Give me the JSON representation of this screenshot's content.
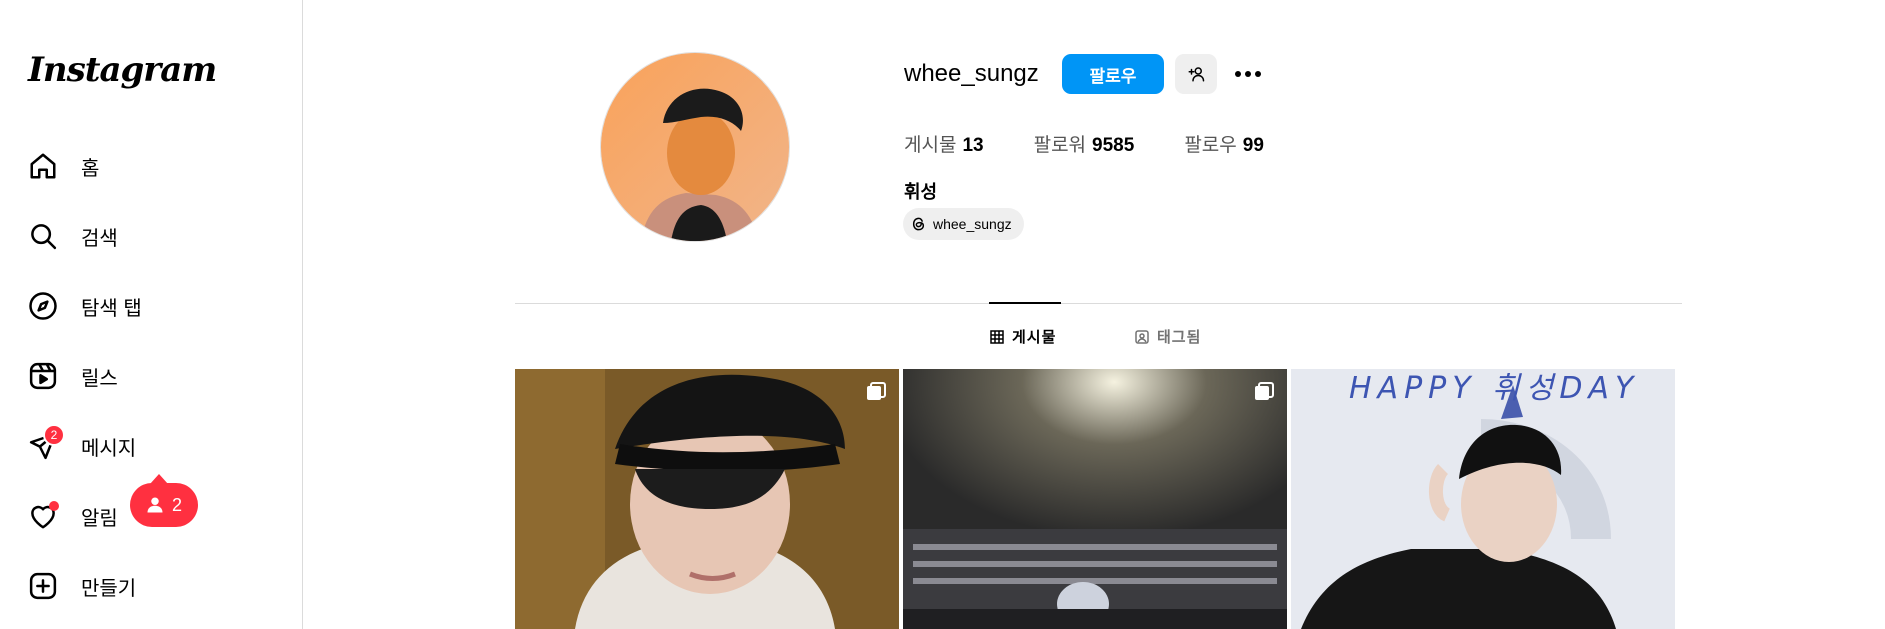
{
  "app": {
    "logo_text": "Instagram"
  },
  "sidebar": {
    "items": [
      {
        "label": "홈",
        "icon": "home-icon"
      },
      {
        "label": "검색",
        "icon": "search-icon"
      },
      {
        "label": "탐색 탭",
        "icon": "explore-icon"
      },
      {
        "label": "릴스",
        "icon": "reels-icon"
      },
      {
        "label": "메시지",
        "icon": "messenger-icon",
        "badge": "2"
      },
      {
        "label": "알림",
        "icon": "heart-icon"
      },
      {
        "label": "만들기",
        "icon": "create-icon"
      }
    ],
    "notification_pill": {
      "count": "2",
      "icon": "person-icon"
    }
  },
  "profile": {
    "username": "whee_sungz",
    "follow_label": "팔로우",
    "stats": [
      {
        "label": "게시물",
        "value": "13"
      },
      {
        "label": "팔로워",
        "value": "9585"
      },
      {
        "label": "팔로우",
        "value": "99"
      }
    ],
    "full_name": "휘성",
    "threads_handle": "whee_sungz"
  },
  "tabs": [
    {
      "label": "게시물",
      "icon": "grid-icon",
      "active": true
    },
    {
      "label": "태그됨",
      "icon": "tagged-icon",
      "active": false
    }
  ],
  "posts": [
    {
      "name": "post-selfie-cap",
      "multi": true
    },
    {
      "name": "post-concert-crowd",
      "multi": true
    },
    {
      "name": "post-birthday",
      "multi": false,
      "overlay_text": "HAPPY 휘성DAY"
    }
  ],
  "colors": {
    "accent": "#0095f6",
    "badge": "#ff3040"
  }
}
